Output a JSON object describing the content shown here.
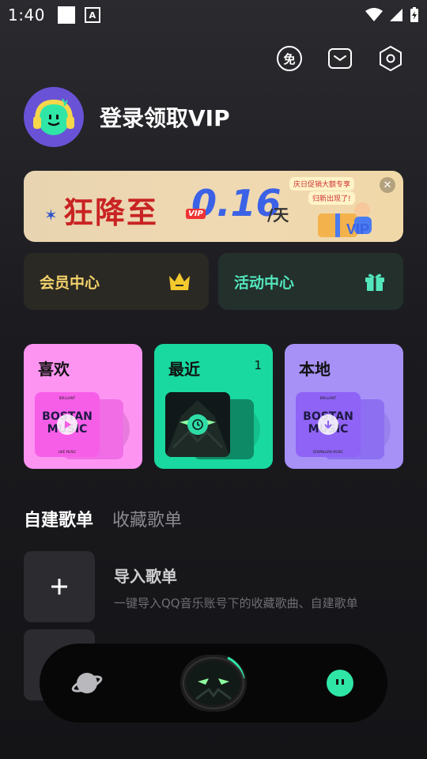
{
  "status_bar": {
    "time": "1:40",
    "notif_a": "A"
  },
  "header": {
    "free_icon_text": "免"
  },
  "profile": {
    "login_text": "登录领取VIP"
  },
  "banner": {
    "title": "狂降至",
    "price": "0.16",
    "unit": "/天",
    "vip_badge": "VIP",
    "tag_1": "庆日促销大额专享",
    "tag_2": "归新出现了!"
  },
  "quick_actions": {
    "vip_center": "会员中心",
    "activity_center": "活动中心"
  },
  "cards": {
    "favorites": {
      "label": "喜欢"
    },
    "recent": {
      "label": "最近",
      "count": "1"
    },
    "local": {
      "label": "本地"
    },
    "cover_title_1": "BOSTAN",
    "cover_title_2": "MUSIC",
    "cover_top": "BRILLIANT",
    "cover_bottom_fav": "LIKE MUSIC",
    "cover_bottom_local": "DOWNLOAD MUSIC"
  },
  "playlist_tabs": {
    "created": "自建歌单",
    "collected": "收藏歌单"
  },
  "import": {
    "title": "导入歌单",
    "description": "一键导入QQ音乐账号下的收藏歌曲、自建歌单"
  },
  "colors": {
    "favorites_card": "#fd94f2",
    "recent_card": "#19d8a0",
    "local_card": "#a791f7",
    "vip_text": "#f3d26a",
    "activity_text": "#53e6bd"
  }
}
